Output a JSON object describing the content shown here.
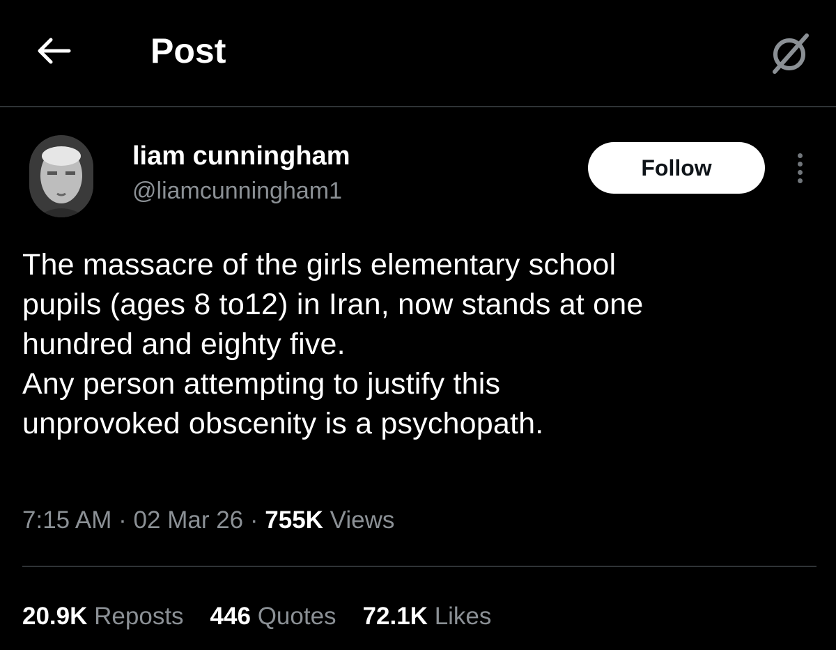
{
  "header": {
    "title": "Post",
    "back_icon": "arrow-left-icon",
    "settings_icon": "slashed-circle-icon"
  },
  "author": {
    "display_name": "liam cunningham",
    "handle": "@liamcunningham1",
    "avatar": "avatar-photo",
    "follow_label": "Follow",
    "more_icon": "more-vertical-icon"
  },
  "tweet": {
    "lines": [
      "The massacre of the girls elementary school",
      "pupils (ages 8 to12) in Iran, now stands at one",
      "hundred and eighty five.",
      "Any person attempting to justify this",
      "unprovoked obscenity is a psychopath."
    ]
  },
  "meta": {
    "time": "7:15 AM",
    "separator": "·",
    "date": "02 Mar 26",
    "views_count": "755K",
    "views_label": "Views"
  },
  "stats": {
    "reposts_count": "20.9K",
    "reposts_label": "Reposts",
    "quotes_count": "446",
    "quotes_label": "Quotes",
    "likes_count": "72.1K",
    "likes_label": "Likes"
  },
  "colors": {
    "background": "#000000",
    "primary_text": "#ffffff",
    "secondary_text": "#8b9095",
    "divider": "#2f3336",
    "follow_bg": "#ffffff"
  }
}
